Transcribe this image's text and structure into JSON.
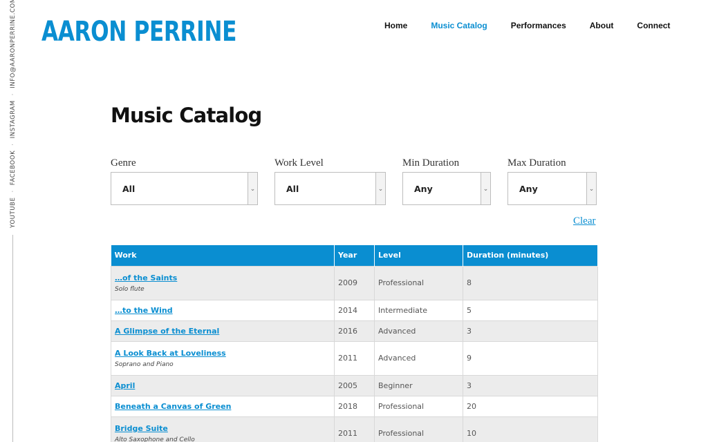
{
  "social": {
    "youtube": "YOUTUBE",
    "facebook": "FACEBOOK",
    "instagram": "INSTAGRAM",
    "email": "INFO@AARONPERRINE.COM",
    "separator": "·"
  },
  "site": {
    "logo": "AARON PERRINE"
  },
  "nav": [
    {
      "label": "Home",
      "active": false
    },
    {
      "label": "Music Catalog",
      "active": true
    },
    {
      "label": "Performances",
      "active": false
    },
    {
      "label": "About",
      "active": false
    },
    {
      "label": "Connect",
      "active": false
    }
  ],
  "page": {
    "title": "Music Catalog"
  },
  "filters": {
    "genre": {
      "label": "Genre",
      "value": "All"
    },
    "work_level": {
      "label": "Work Level",
      "value": "All"
    },
    "min_duration": {
      "label": "Min Duration",
      "value": "Any"
    },
    "max_duration": {
      "label": "Max Duration",
      "value": "Any"
    },
    "clear_label": "Clear"
  },
  "table": {
    "headers": [
      "Work",
      "Year",
      "Level",
      "Duration (minutes)"
    ],
    "rows": [
      {
        "title": "…of the Saints",
        "sub": "Solo flute",
        "year": "2009",
        "level": "Professional",
        "duration": "8"
      },
      {
        "title": "…to the Wind",
        "sub": "",
        "year": "2014",
        "level": "Intermediate",
        "duration": "5"
      },
      {
        "title": "A Glimpse of the Eternal",
        "sub": "",
        "year": "2016",
        "level": "Advanced",
        "duration": "3"
      },
      {
        "title": "A Look Back at Loveliness",
        "sub": "Soprano and Piano",
        "year": "2011",
        "level": "Advanced",
        "duration": "9"
      },
      {
        "title": "April",
        "sub": "",
        "year": "2005",
        "level": "Beginner",
        "duration": "3"
      },
      {
        "title": "Beneath a Canvas of Green",
        "sub": "",
        "year": "2018",
        "level": "Professional",
        "duration": "20"
      },
      {
        "title": "Bridge Suite",
        "sub": "Alto Saxophone and Cello",
        "year": "2011",
        "level": "Professional",
        "duration": "10"
      }
    ]
  },
  "colors": {
    "accent": "#0a8ed1",
    "row_shade": "#ececec"
  }
}
